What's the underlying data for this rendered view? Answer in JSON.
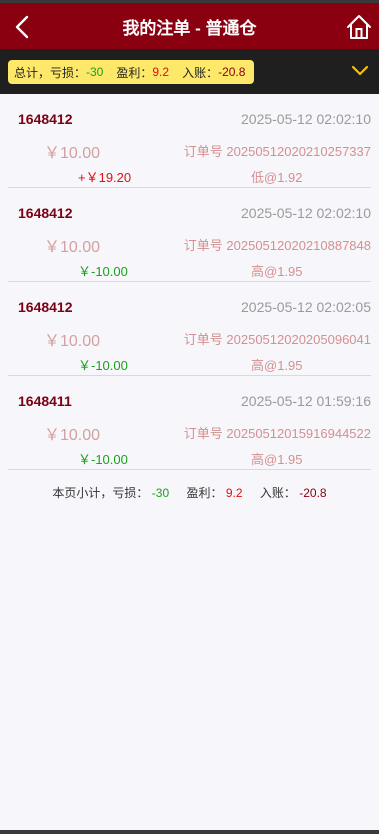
{
  "header": {
    "title": "我的注单 - 普通仓"
  },
  "summary": {
    "prefix": "总计，亏损：",
    "loss": "-30",
    "profit_label": "盈利：",
    "profit": "9.2",
    "income_label": "入账：",
    "income": "-20.8"
  },
  "orders": [
    {
      "uid": "1648412",
      "time": "2025-05-12 02:02:10",
      "amount": "￥10.00",
      "order_no": "订单号 20250512020210257337",
      "result": "+￥19.20",
      "result_type": "win",
      "bet": "低@1.92"
    },
    {
      "uid": "1648412",
      "time": "2025-05-12 02:02:10",
      "amount": "￥10.00",
      "order_no": "订单号 20250512020210887848",
      "result": "￥-10.00",
      "result_type": "loss",
      "bet": "高@1.95"
    },
    {
      "uid": "1648412",
      "time": "2025-05-12 02:02:05",
      "amount": "￥10.00",
      "order_no": "订单号 20250512020205096041",
      "result": "￥-10.00",
      "result_type": "loss",
      "bet": "高@1.95"
    },
    {
      "uid": "1648411",
      "time": "2025-05-12 01:59:16",
      "amount": "￥10.00",
      "order_no": "订单号 20250512015916944522",
      "result": "￥-10.00",
      "result_type": "loss",
      "bet": "高@1.95"
    }
  ],
  "page_summary": {
    "prefix": "本页小计，亏损：",
    "loss": "-30",
    "profit_label": "盈利：",
    "profit": "9.2",
    "income_label": "入账：",
    "income": "-20.8"
  },
  "icons": {
    "back": "chevron-left-icon",
    "home": "home-icon",
    "expand": "chevron-down-icon"
  },
  "colors": {
    "header_bg": "#8a0010",
    "summary_pill": "#fde869",
    "win": "#e01010",
    "loss": "#19a219"
  }
}
